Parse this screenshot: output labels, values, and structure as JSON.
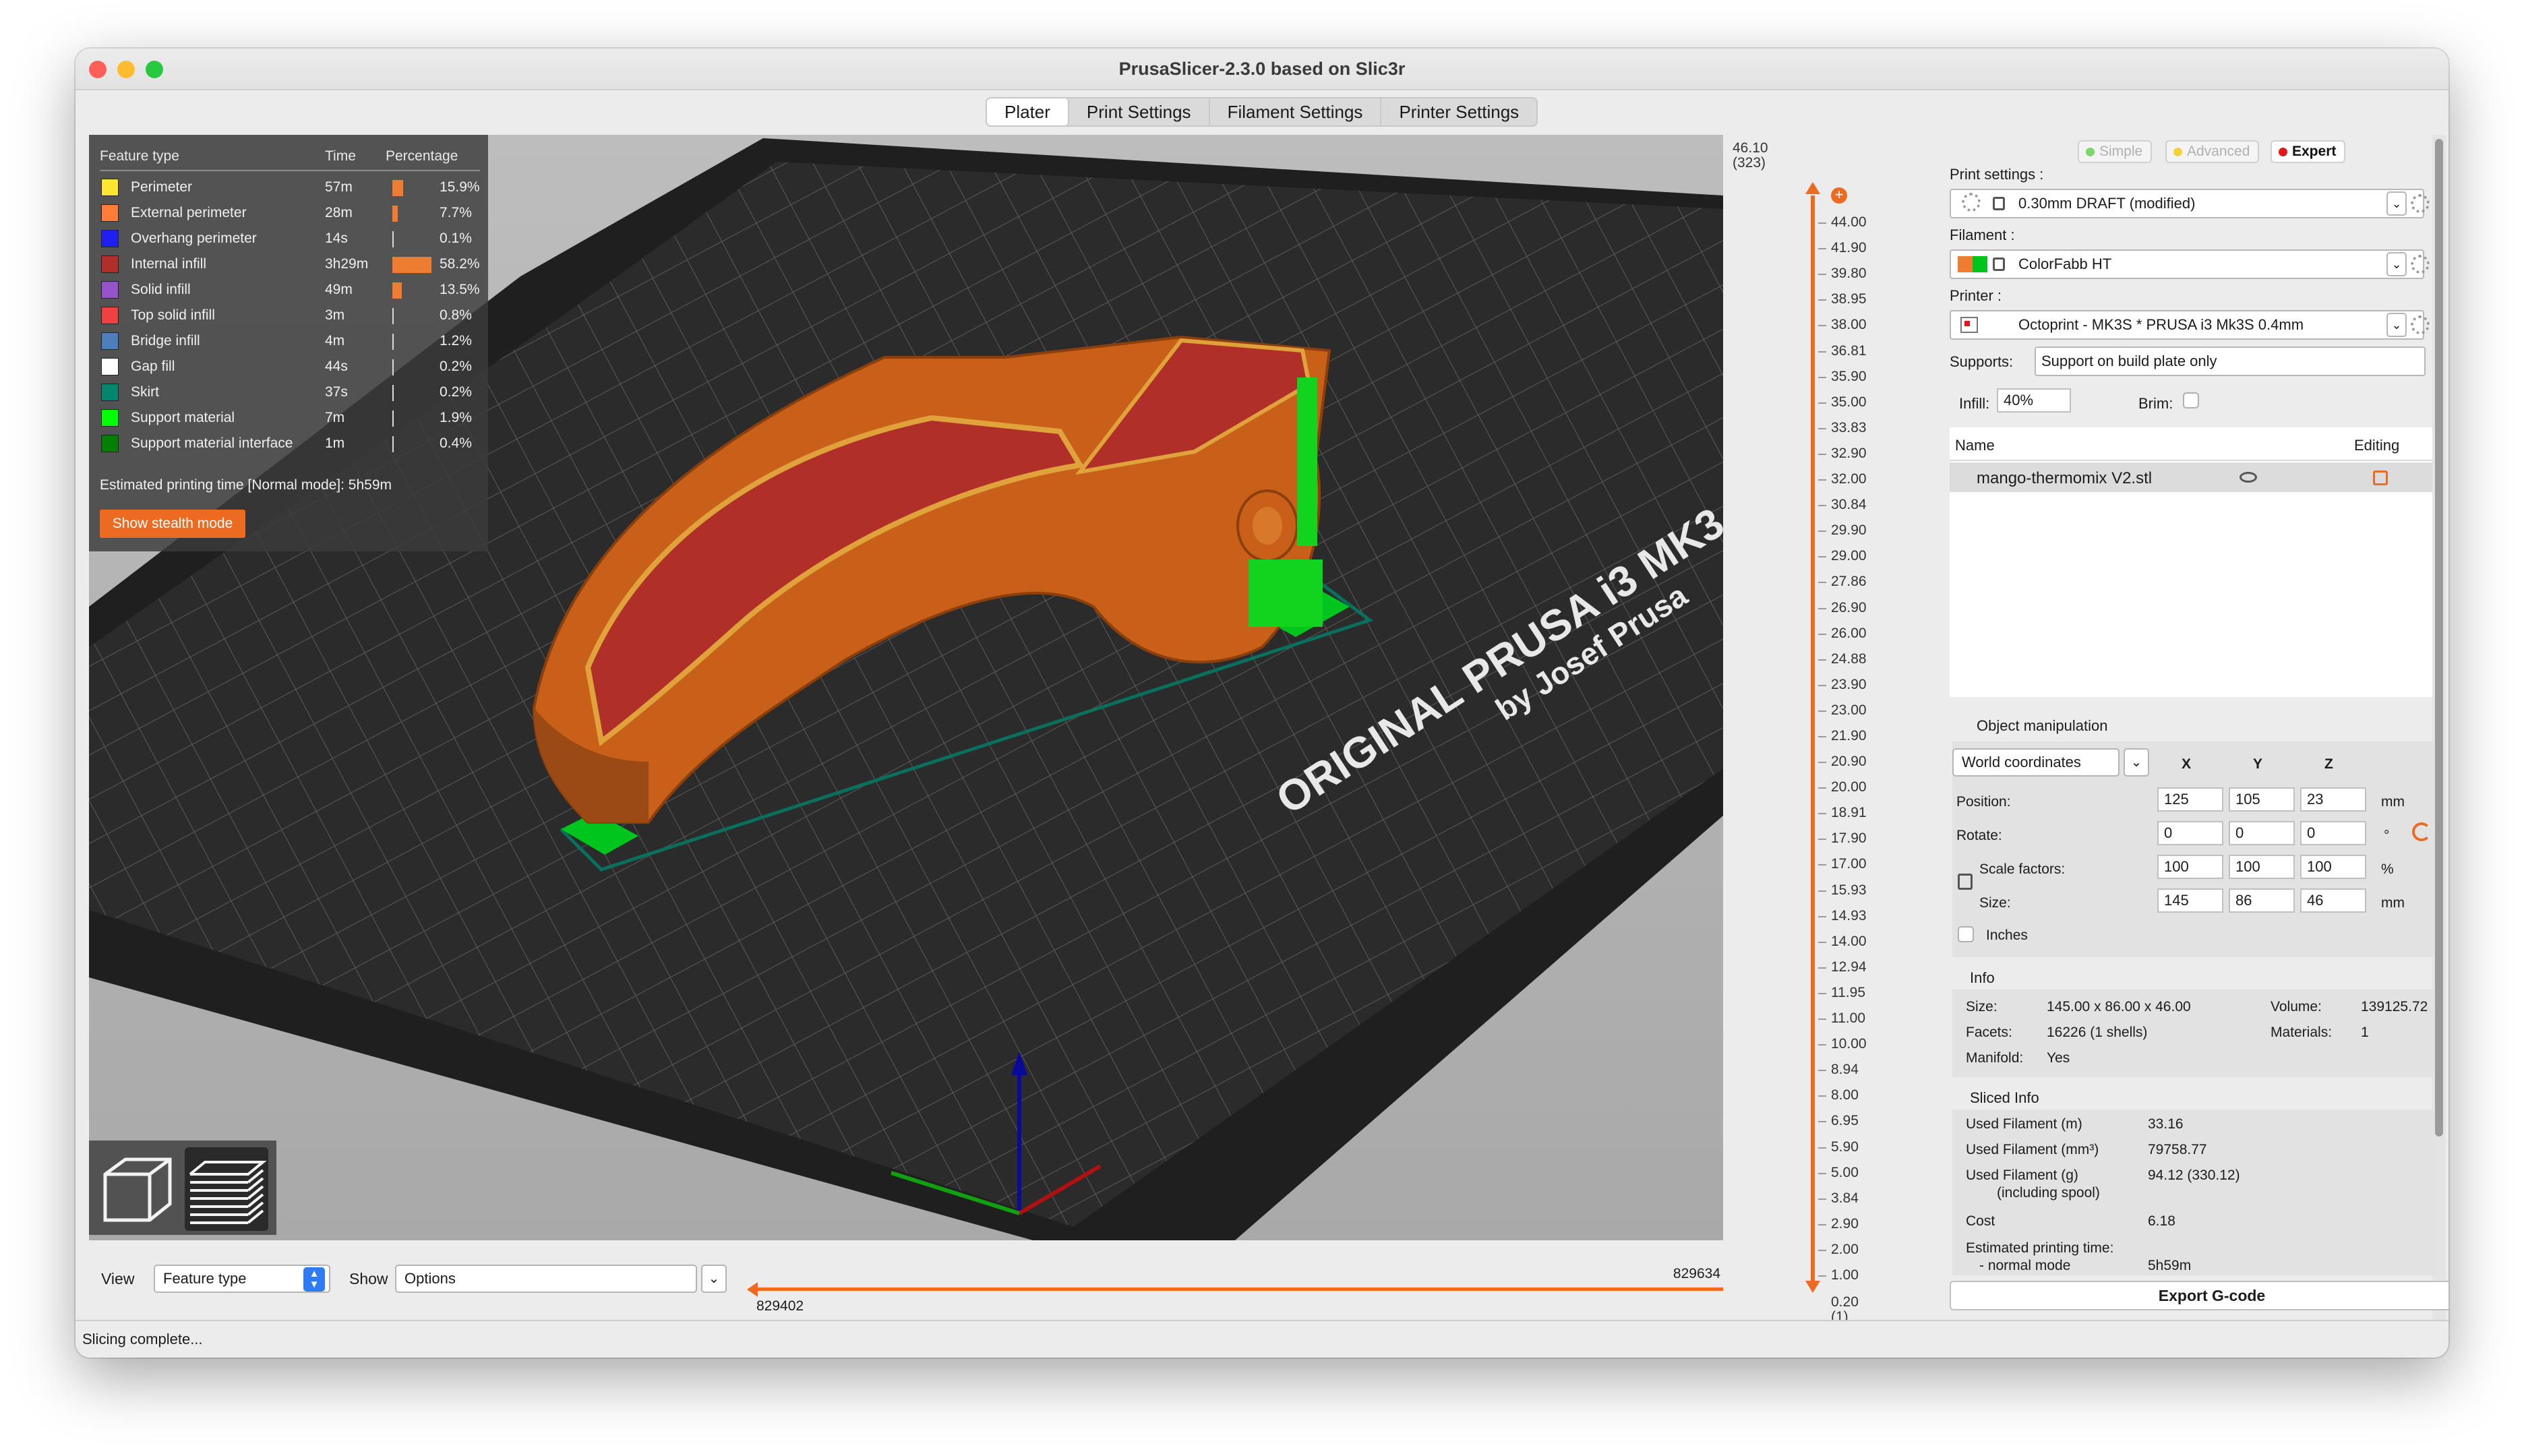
{
  "window": {
    "title": "PrusaSlicer-2.3.0 based on Slic3r"
  },
  "tabs": [
    "Plater",
    "Print Settings",
    "Filament Settings",
    "Printer Settings"
  ],
  "legend": {
    "headers": {
      "feature": "Feature type",
      "time": "Time",
      "percentage": "Percentage"
    },
    "rows": [
      {
        "name": "Perimeter",
        "time": "57m",
        "percent": "15.9%",
        "fraction": 0.159,
        "color": "#ffe631"
      },
      {
        "name": "External perimeter",
        "time": "28m",
        "percent": "7.7%",
        "fraction": 0.077,
        "color": "#ff7d38"
      },
      {
        "name": "Overhang perimeter",
        "time": "14s",
        "percent": "0.1%",
        "fraction": 0.001,
        "color": "#1f1ff2"
      },
      {
        "name": "Internal infill",
        "time": "3h29m",
        "percent": "58.2%",
        "fraction": 0.582,
        "color": "#b03029"
      },
      {
        "name": "Solid infill",
        "time": "49m",
        "percent": "13.5%",
        "fraction": 0.135,
        "color": "#9654cc"
      },
      {
        "name": "Top solid infill",
        "time": "3m",
        "percent": "0.8%",
        "fraction": 0.008,
        "color": "#f04040"
      },
      {
        "name": "Bridge infill",
        "time": "4m",
        "percent": "1.2%",
        "fraction": 0.012,
        "color": "#4d80ba"
      },
      {
        "name": "Gap fill",
        "time": "44s",
        "percent": "0.2%",
        "fraction": 0.002,
        "color": "#ffffff"
      },
      {
        "name": "Skirt",
        "time": "37s",
        "percent": "0.2%",
        "fraction": 0.002,
        "color": "#00876e"
      },
      {
        "name": "Support material",
        "time": "7m",
        "percent": "1.9%",
        "fraction": 0.019,
        "color": "#00ff00"
      },
      {
        "name": "Support material interface",
        "time": "1m",
        "percent": "0.4%",
        "fraction": 0.004,
        "color": "#008000"
      }
    ],
    "estimated": "Estimated printing time [Normal mode]:  5h59m",
    "stealth_button": "Show stealth mode"
  },
  "bed": {
    "brand": "ORIGINAL PRUSA i3 MK3",
    "byline": "by Josef Prusa"
  },
  "view_bar": {
    "view_label": "View",
    "view_value": "Feature type",
    "show_label": "Show",
    "show_value": "Options",
    "slider_low": "829402",
    "slider_high": "829634"
  },
  "vertical_slider": {
    "top_value": "46.10",
    "top_layer": "(323)",
    "bottom_value": "0.20",
    "bottom_layer": "(1)",
    "ticks": [
      "46.10",
      "44.00",
      "41.90",
      "39.80",
      "38.95",
      "38.00",
      "36.81",
      "35.90",
      "35.00",
      "33.83",
      "32.90",
      "32.00",
      "30.84",
      "29.90",
      "29.00",
      "27.86",
      "26.90",
      "26.00",
      "24.88",
      "23.90",
      "23.00",
      "21.90",
      "20.90",
      "20.00",
      "18.91",
      "17.90",
      "17.00",
      "15.93",
      "14.93",
      "14.00",
      "12.94",
      "11.95",
      "11.00",
      "10.00",
      "8.94",
      "8.00",
      "6.95",
      "5.90",
      "5.00",
      "3.84",
      "2.90",
      "2.00",
      "1.00"
    ]
  },
  "sidebar": {
    "modes": {
      "simple": "Simple",
      "advanced": "Advanced",
      "expert": "Expert"
    },
    "print_settings_label": "Print settings :",
    "print_settings_value": "0.30mm DRAFT (modified)",
    "filament_label": "Filament :",
    "filament_value": "ColorFabb HT",
    "printer_label": "Printer :",
    "printer_value": "Octoprint - MK3S * PRUSA i3 Mk3S 0.4mm",
    "supports_label": "Supports:",
    "supports_value": "Support on build plate only",
    "infill_label": "Infill:",
    "infill_value": "40%",
    "brim_label": "Brim:",
    "object_list": {
      "name_header": "Name",
      "editing_header": "Editing",
      "objects": [
        "mango-thermomix V2.stl"
      ]
    },
    "object_manipulation": {
      "title": "Object manipulation",
      "coordinates": "World coordinates",
      "axes": [
        "X",
        "Y",
        "Z"
      ],
      "position_label": "Position:",
      "position": [
        "125",
        "105",
        "23"
      ],
      "position_unit": "mm",
      "rotate_label": "Rotate:",
      "rotate": [
        "0",
        "0",
        "0"
      ],
      "rotate_unit": "°",
      "scale_label": "Scale factors:",
      "scale": [
        "100",
        "100",
        "100"
      ],
      "scale_unit": "%",
      "size_label": "Size:",
      "size": [
        "145",
        "86",
        "46"
      ],
      "size_unit": "mm",
      "inches_label": "Inches"
    },
    "info": {
      "title": "Info",
      "size_label": "Size:",
      "size": "145.00 x 86.00 x 46.00",
      "volume_label": "Volume:",
      "volume": "139125.72",
      "facets_label": "Facets:",
      "facets": "16226 (1 shells)",
      "materials_label": "Materials:",
      "materials": "1",
      "manifold_label": "Manifold:",
      "manifold": "Yes"
    },
    "sliced_info": {
      "title": "Sliced Info",
      "filament_m_label": "Used Filament (m)",
      "filament_m": "33.16",
      "filament_mm3_label": "Used Filament (mm³)",
      "filament_mm3": "79758.77",
      "filament_g_label": "Used Filament (g)",
      "filament_g_sub": "(including spool)",
      "filament_g": "94.12 (330.12)",
      "cost_label": "Cost",
      "cost": "6.18",
      "time_label": "Estimated printing time:",
      "time_mode": "- normal mode",
      "time": "5h59m"
    },
    "export_button": "Export G-code"
  },
  "status": "Slicing complete...",
  "colors": {
    "accent": "#ed6b21",
    "bed": "#262626",
    "model": "#c8601a",
    "support": "#00e01f"
  }
}
